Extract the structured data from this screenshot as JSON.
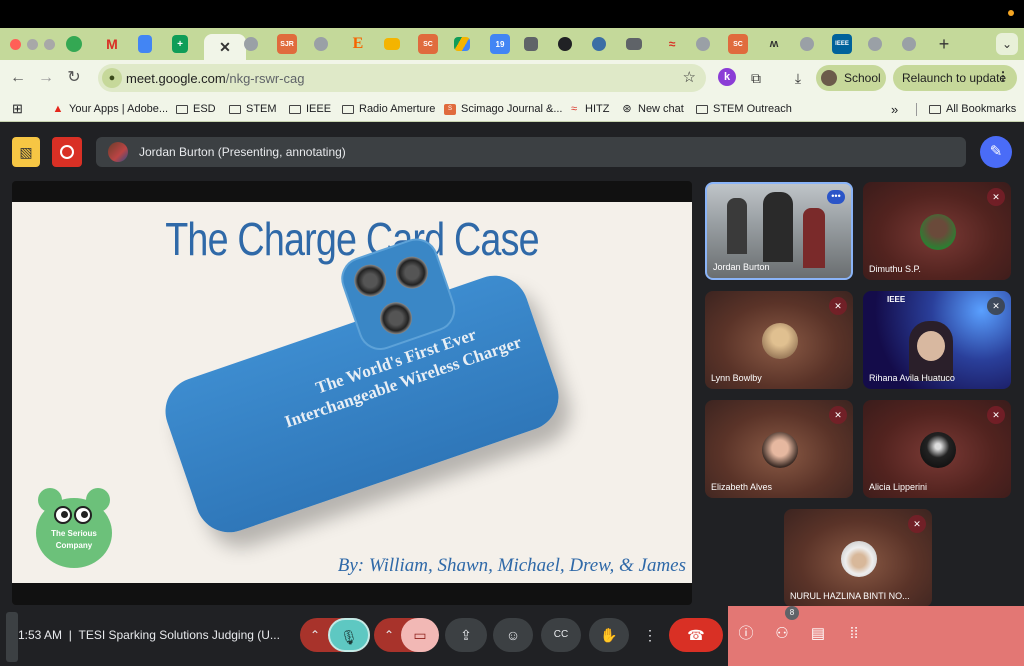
{
  "browser": {
    "url_domain": "meet.google.com",
    "url_path": "/nkg-rswr-cag",
    "profile_label": "School",
    "relaunch_label": "Relaunch to update",
    "tab_labels": [
      "SJR",
      "E",
      "SC",
      "19",
      "SC",
      "IEEE"
    ]
  },
  "bookmarks": [
    {
      "label": "Your Apps | Adobe...",
      "icon": "adobe-icon"
    },
    {
      "label": "ESD",
      "icon": "folder-icon"
    },
    {
      "label": "STEM",
      "icon": "folder-icon"
    },
    {
      "label": "IEEE",
      "icon": "folder-icon"
    },
    {
      "label": "Radio Amerture",
      "icon": "folder-icon"
    },
    {
      "label": "Scimago Journal &...",
      "icon": "sjr-icon"
    },
    {
      "label": "HITZ",
      "icon": "hitz-icon"
    },
    {
      "label": "New chat",
      "icon": "chatgpt-icon"
    },
    {
      "label": "STEM Outreach",
      "icon": "folder-icon"
    }
  ],
  "bookmarks_overflow": "»",
  "all_bookmarks": "All Bookmarks",
  "meet": {
    "presenter_banner": "Jordan Burton (Presenting, annotating)",
    "slide": {
      "title": "The Charge Card Case",
      "phone_text_line1": "The World's First Ever",
      "phone_text_line2": "Interchangeable Wireless Charger",
      "byline": "By: William, Shawn, Michael, Drew, & James",
      "logo_line1": "The Serious",
      "logo_line2": "Company"
    },
    "participants": [
      {
        "name": "Jordan Burton"
      },
      {
        "name": "Dimuthu S.P."
      },
      {
        "name": "Lynn Bowlby"
      },
      {
        "name": "Rihana Avila Huatuco"
      },
      {
        "name": "Elizabeth Alves"
      },
      {
        "name": "Alicia Lipperini"
      },
      {
        "name": "NURUL HAZLINA BINTI NO..."
      }
    ],
    "ieee_label": "IEEE",
    "time": "1:53 AM",
    "separator": "|",
    "meeting_title": "TESI Sparking Solutions Judging (U...",
    "people_count": "8"
  },
  "colors": {
    "accent": "#4a6cf7",
    "tab_bar": "#c4d99a",
    "hangup": "#d93025",
    "side_panel": "#e37774"
  }
}
